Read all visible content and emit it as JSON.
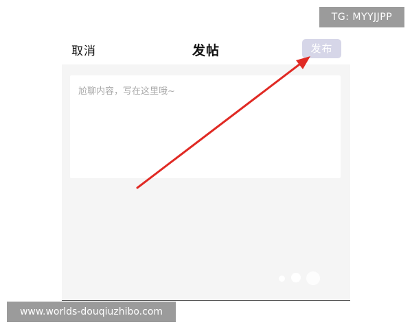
{
  "header": {
    "cancel_label": "取消",
    "title": "发帖",
    "publish_label": "发布"
  },
  "editor": {
    "placeholder": "尬聊内容，写在这里哦~",
    "value": ""
  },
  "watermarks": {
    "top": "TG: MYYJJPP",
    "bottom": "www.worlds-douqiuzhibo.com"
  },
  "colors": {
    "arrow": "#e02a24",
    "publish_button_bg": "#d6d6e8",
    "body_bg": "#f5f5f5"
  }
}
